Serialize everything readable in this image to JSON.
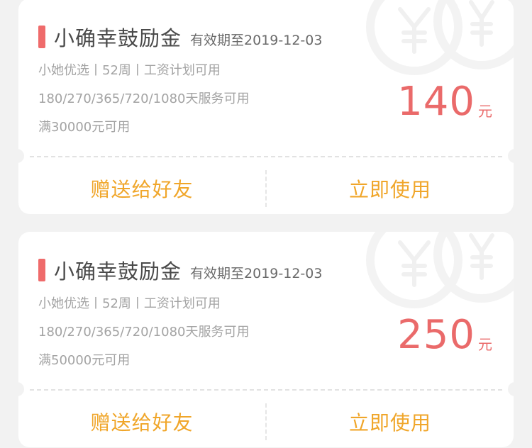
{
  "coupons": [
    {
      "title": "小确幸鼓励金",
      "expire": "有效期至2019-12-03",
      "desc1": "小她优选丨52周丨工资计划可用",
      "desc2": "180/270/365/720/1080天服务可用",
      "desc3": "满30000元可用",
      "amount": "140",
      "unit": "元",
      "gift_label": "赠送给好友",
      "use_label": "立即使用"
    },
    {
      "title": "小确幸鼓励金",
      "expire": "有效期至2019-12-03",
      "desc1": "小她优选丨52周丨工资计划可用",
      "desc2": "180/270/365/720/1080天服务可用",
      "desc3": "满50000元可用",
      "amount": "250",
      "unit": "元",
      "gift_label": "赠送给好友",
      "use_label": "立即使用"
    }
  ],
  "colors": {
    "accent_red": "#ea6a6a",
    "action_orange": "#f0a62a",
    "background": "#f2f2f2"
  },
  "icons": {
    "watermark": "yen-coin-icon"
  }
}
